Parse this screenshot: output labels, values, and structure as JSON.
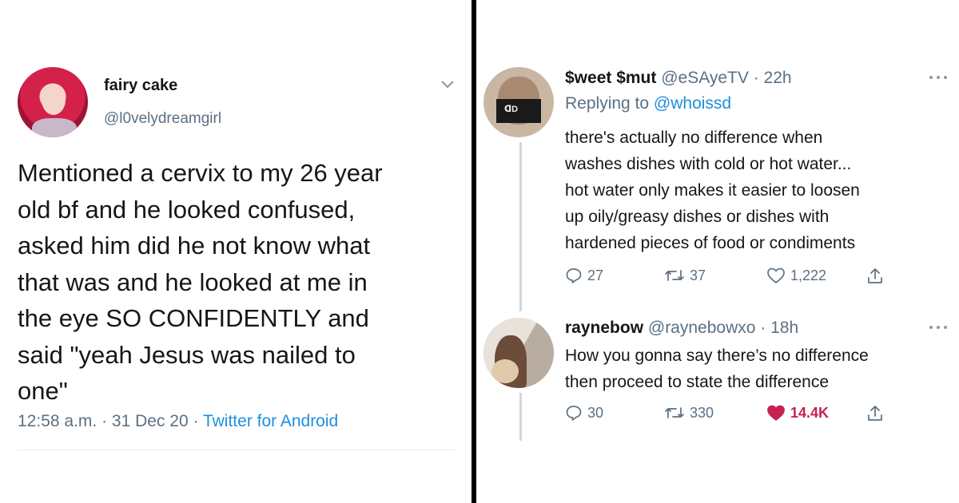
{
  "left_tweet": {
    "display_name": "fairy cake",
    "handle": "@l0velydreamgirl",
    "text_lines": [
      "Mentioned a cervix to my 26 year",
      "old bf and he looked confused,",
      "asked him did he not know what",
      "that was and he looked at me in",
      "the eye SO CONFIDENTLY and",
      "said \"yeah Jesus was nailed to",
      "one\""
    ],
    "time": "12:58 a.m.",
    "date": "31 Dec 20",
    "source": "Twitter for Android",
    "separator": "·",
    "icons": {
      "menu": "chevron-down-icon",
      "avatar": "avatar"
    }
  },
  "replies": [
    {
      "display_name": "$weet $mut",
      "handle": "@eSAyeTV",
      "time_ago": "22h",
      "replying_to_label": "Replying to",
      "replying_to_mention": "@whoissd",
      "text_lines": [
        "there's actually no difference when",
        "washes dishes with cold or hot water...",
        "hot water only makes it easier to loosen",
        "up oily/greasy dishes or dishes with",
        "hardened pieces of food or condiments"
      ],
      "reply_count": "27",
      "retweet_count": "37",
      "like_count": "1,222",
      "liked": false
    },
    {
      "display_name": "raynebow",
      "handle": "@raynebowxo",
      "time_ago": "18h",
      "text_lines": [
        "How you gonna say there’s no difference",
        "then proceed to state the difference"
      ],
      "reply_count": "30",
      "retweet_count": "330",
      "like_count": "14.4K",
      "liked": true
    }
  ],
  "colors": {
    "text": "#14171a",
    "secondary": "#5b7083",
    "link": "#1d8fde",
    "like_active": "#c8204f",
    "divider": "#000000"
  }
}
